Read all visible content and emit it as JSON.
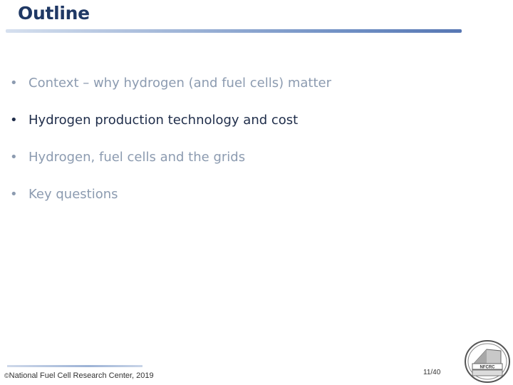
{
  "slide": {
    "title": "Outline",
    "bullet_glyph": "•",
    "items": [
      {
        "label": "Context – why hydrogen (and fuel cells) matter",
        "state": "muted"
      },
      {
        "label": "Hydrogen production technology and cost",
        "state": "active"
      },
      {
        "label": "Hydrogen, fuel cells and the grids",
        "state": "muted"
      },
      {
        "label": "Key questions",
        "state": "muted"
      }
    ]
  },
  "footer": {
    "copyright_mark": "©",
    "copyright": "National Fuel Cell Research Center, 2019",
    "page_number": "11/40",
    "logo_text": "NFCRC"
  },
  "colors": {
    "title": "#1f3864",
    "active_text": "#1f2d4a",
    "muted_text": "#8c9bb0",
    "rule_accent": "#5777b3"
  }
}
